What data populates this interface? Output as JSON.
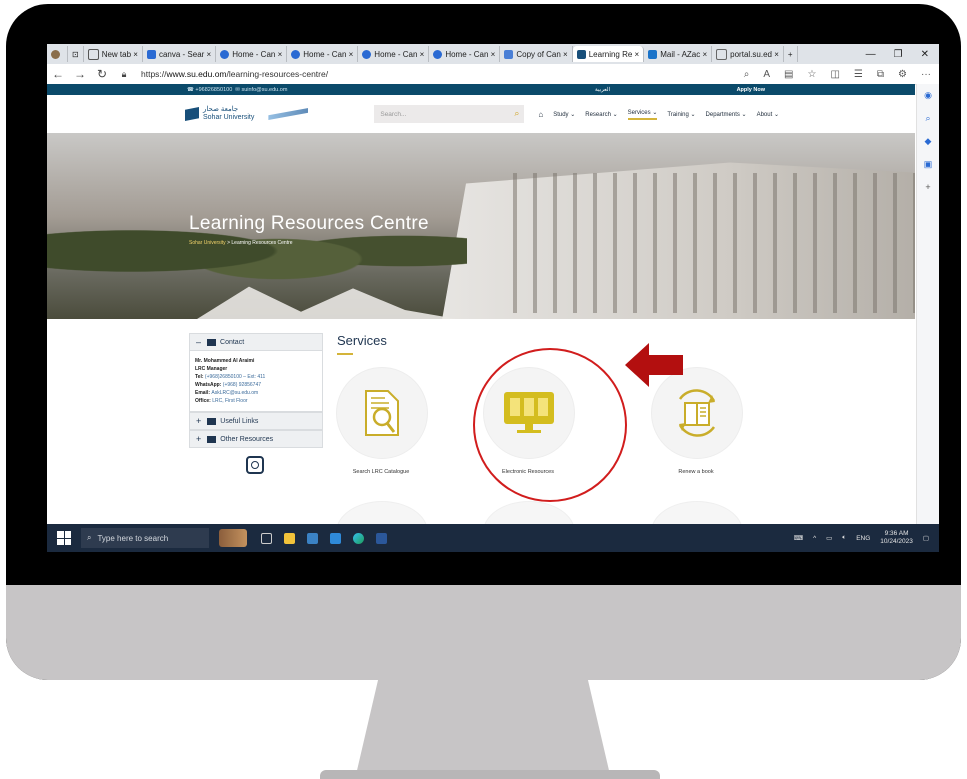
{
  "browser": {
    "tabs": [
      {
        "label": "New tab",
        "icon": "newtab-icon",
        "color": "#555555"
      },
      {
        "label": "canva - Sear",
        "icon": "search-icon",
        "color": "#2a6ad3"
      },
      {
        "label": "Home - Can",
        "icon": "canvas-icon",
        "color": "#2a6ad3"
      },
      {
        "label": "Home - Can",
        "icon": "canvas-icon",
        "color": "#2a6ad3"
      },
      {
        "label": "Home - Can",
        "icon": "canvas-icon",
        "color": "#2a6ad3"
      },
      {
        "label": "Home - Can",
        "icon": "canvas-icon",
        "color": "#2a6ad3"
      },
      {
        "label": "Copy of Can",
        "icon": "canva-icon",
        "color": "#4a7fd6"
      },
      {
        "label": "Learning Re",
        "icon": "sohar-icon",
        "color": "#184f7a",
        "active": true
      },
      {
        "label": "Mail - AZac",
        "icon": "outlook-icon",
        "color": "#1a73c9"
      },
      {
        "label": "portal.su.ed",
        "icon": "page-icon",
        "color": "#666666"
      }
    ],
    "url_prefix": "https://",
    "url_host": "www.su.edu.om",
    "url_path": "/learning-resources-centre/"
  },
  "site": {
    "phone": "+96826850100",
    "email": "suinfo@su.edu.om",
    "apply_now": "Apply Now",
    "arabic_link": "العربية",
    "logo_arabic": "جامعة صحار",
    "logo_english": "Sohar University",
    "search_placeholder": "Search...",
    "menu": [
      "Study",
      "Research",
      "Services",
      "Training",
      "Departments",
      "About"
    ],
    "active_menu": "Services"
  },
  "hero": {
    "title": "Learning Resources Centre",
    "crumb_home": "Sohar University",
    "crumb_sep": " > ",
    "crumb_current": "Learning Resources Centre"
  },
  "sidebar": {
    "contact_label": "Contact",
    "contact_lines": [
      {
        "k": "Mr. Mohammed Al Araimi",
        "v": ""
      },
      {
        "k": "LRC Manager",
        "v": ""
      },
      {
        "k": "Tel: ",
        "v": "(+968)26850100 – Ext: 411"
      },
      {
        "k": "WhatsApp: ",
        "v": "(+968) 92856747"
      },
      {
        "k": "Email: ",
        "v": "AskLRC@su.edu.om"
      },
      {
        "k": "Office: ",
        "v": "LRC, First Floor"
      }
    ],
    "useful_links": "Useful Links",
    "other_resources": "Other Resources"
  },
  "services": {
    "title": "Services",
    "items": [
      {
        "label": "Search LRC Catalogue",
        "icon": "catalogue-search-icon"
      },
      {
        "label": "Electronic Resources",
        "icon": "electronic-resources-icon"
      },
      {
        "label": "Renew a book",
        "icon": "renew-book-icon"
      }
    ],
    "accent": "#d4b43a"
  },
  "annotation": {
    "circle_color": "#d11d1d",
    "arrow_color": "#b30f0f"
  },
  "taskbar": {
    "search_placeholder": "Type here to search",
    "lang": "ENG",
    "time": "9:36 AM",
    "date": "10/24/2023"
  }
}
